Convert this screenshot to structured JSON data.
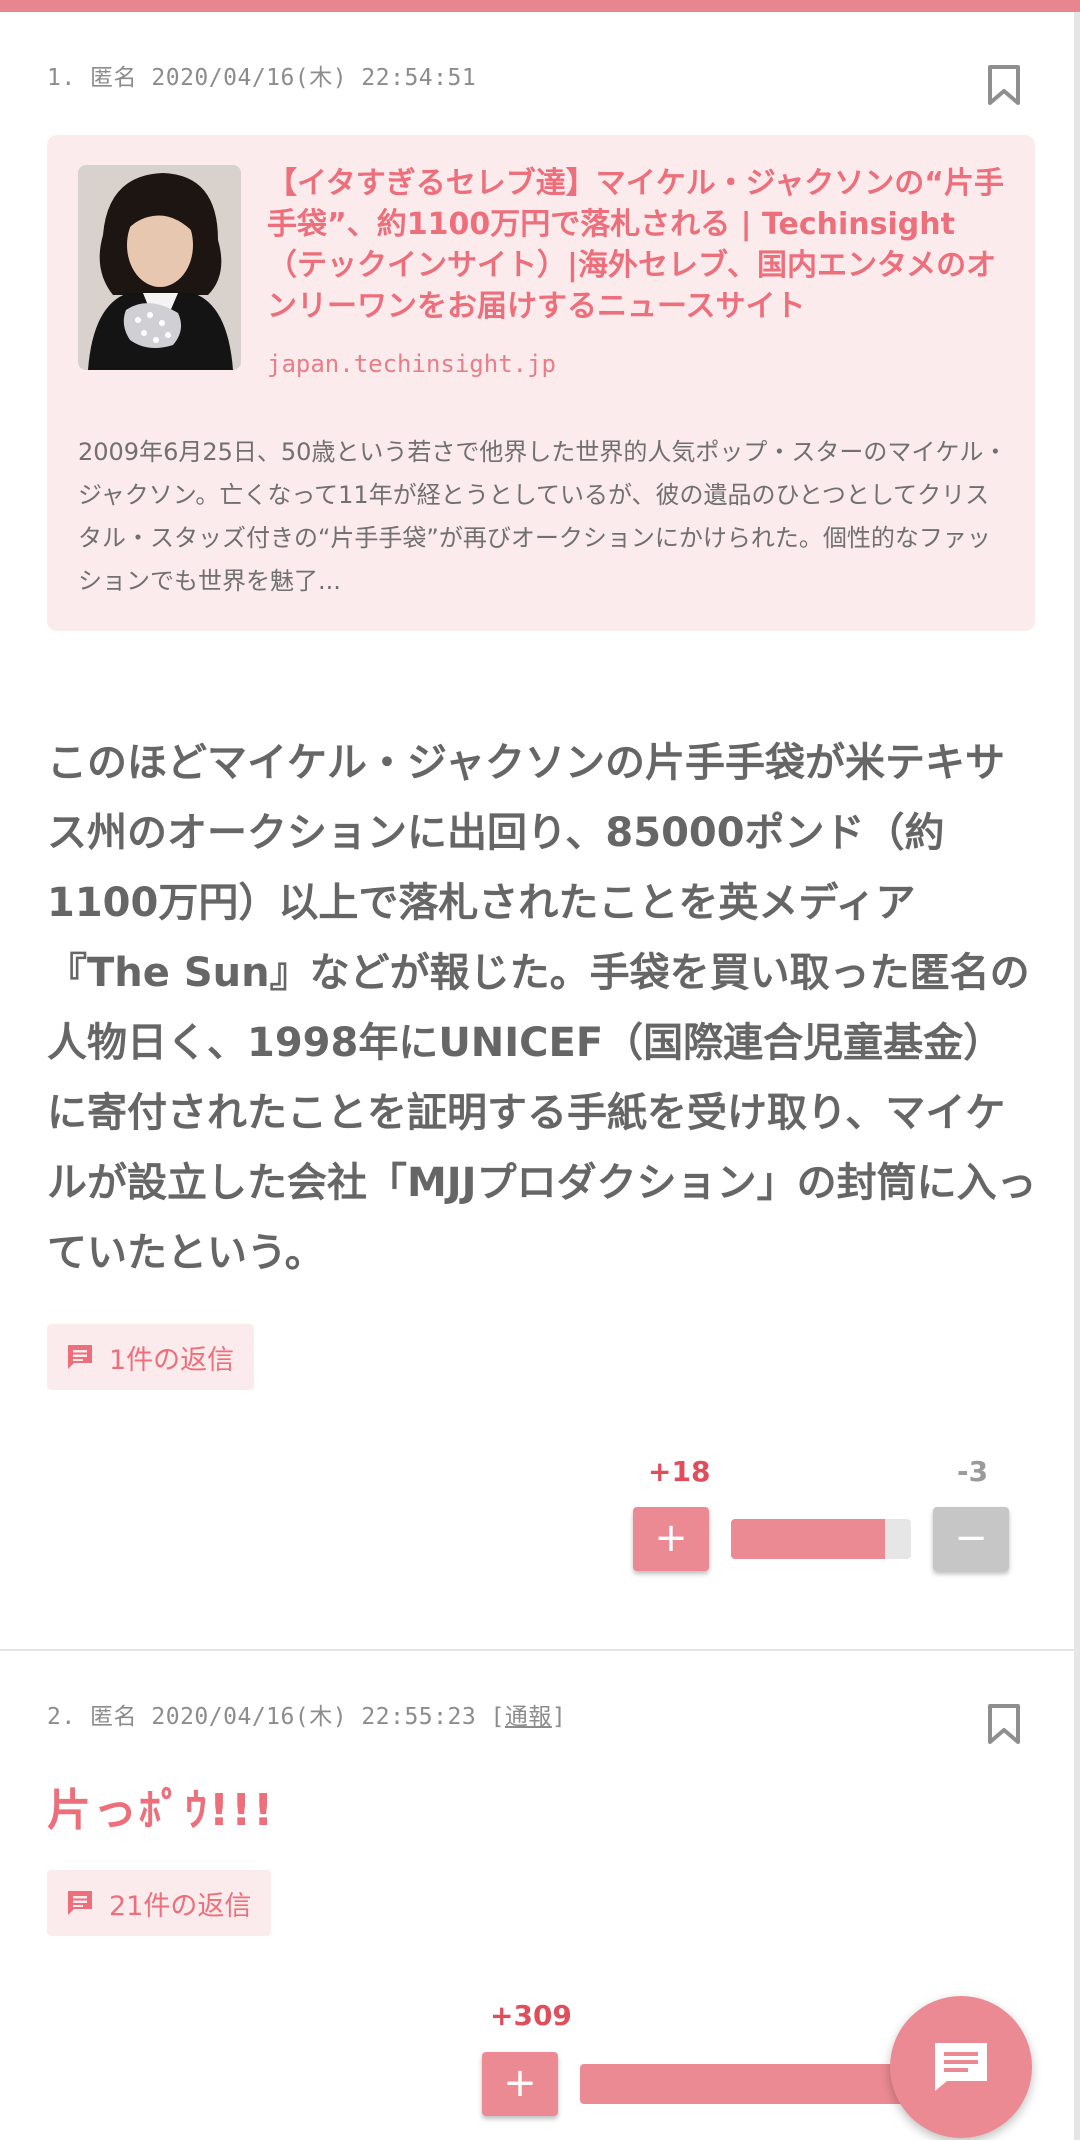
{
  "colors": {
    "accent": "#ec8a93",
    "accent_text": "#ec6f7b",
    "plus_count": "#e04e5b",
    "card_bg": "#fcebec"
  },
  "comments": [
    {
      "meta": "1. 匿名 2020/04/16(木) 22:54:51",
      "link_card": {
        "title": "【イタすぎるセレブ達】マイケル・ジャクソンの“片手手袋”、約1100万円で落札される | Techinsight（テックインサイト）|海外セレブ、国内エンタメのオンリーワンをお届けするニュースサイト",
        "domain": "japan.techinsight.jp",
        "description": "2009年6月25日、50歳という若さで他界した世界的人気ポップ・スターのマイケル・ジャクソン。亡くなって11年が経とうとしているが、彼の遺品のひとつとしてクリスタル・スタッズ付きの“片手手袋”が再びオークションにかけられた。個性的なファッションでも世界を魅了..."
      },
      "body": "このほどマイケル・ジャクソンの片手手袋が米テキサス州のオークションに出回り、85000ポンド（約1100万円）以上で落札されたことを英メディア『The Sun』などが報じた。手袋を買い取った匿名の人物日く、1998年にUNICEF（国際連合児童基金）に寄付されたことを証明する手紙を受け取り、マイケルが設立した会社「MJJプロダクション」の封筒に入っていたという。",
      "reply_label": "1件の返信",
      "plus": "+18",
      "minus": "-3",
      "plus_ratio": 0.857,
      "plus_button": "+",
      "minus_button": "−"
    },
    {
      "meta_prefix": "2. 匿名 2020/04/16(木) 22:55:23 ",
      "report_open": "[",
      "report_label": "通報",
      "report_close": "]",
      "body": "片っﾎﾟｳ!!!",
      "reply_label": "21件の返信",
      "plus": "+309",
      "plus_button": "+",
      "plus_ratio": 1.0
    }
  ],
  "icons": {
    "bookmark": "bookmark-icon",
    "reply": "comment-icon",
    "fab": "chat-icon"
  }
}
